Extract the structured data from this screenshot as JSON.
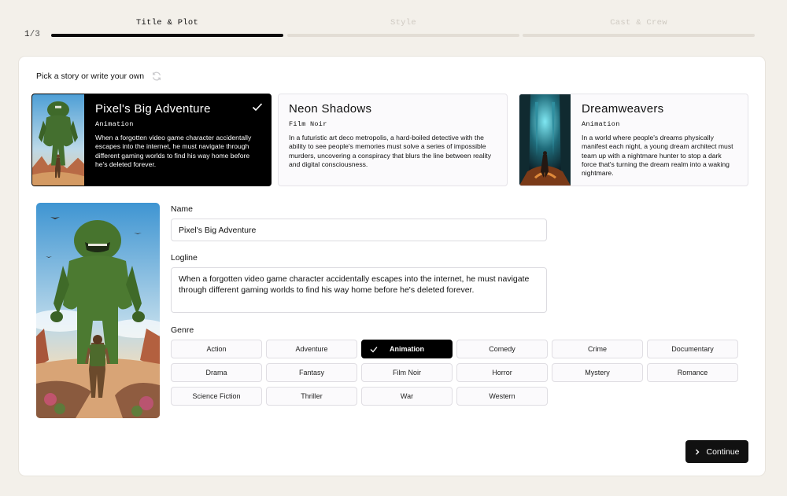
{
  "stepper": {
    "counter_current": "1",
    "counter_total": "/3",
    "steps": [
      {
        "label": "Title & Plot",
        "active": true
      },
      {
        "label": "Style",
        "active": false
      },
      {
        "label": "Cast & Crew",
        "active": false
      }
    ]
  },
  "picker": {
    "label": "Pick a story or write your own",
    "refresh_icon": "refresh-icon"
  },
  "stories": [
    {
      "title": "Pixel's Big Adventure",
      "genre": "Animation",
      "description": "When a forgotten video game character accidentally escapes into the internet, he must navigate through different gaming worlds to find his way home before he's deleted forever.",
      "selected": true
    },
    {
      "title": "Neon Shadows",
      "genre": "Film Noir",
      "description": "In a futuristic art deco metropolis, a hard-boiled detective with the ability to see people's memories must solve a series of impossible murders, uncovering a conspiracy that blurs the line between reality and digital consciousness.",
      "selected": false
    },
    {
      "title": "Dreamweavers",
      "genre": "Animation",
      "description": "In a world where people's dreams physically manifest each night, a young dream architect must team up with a nightmare hunter to stop a dark force that's turning the dream realm into a waking nightmare.",
      "selected": false
    }
  ],
  "form": {
    "name_label": "Name",
    "name_value": "Pixel's Big Adventure",
    "logline_label": "Logline",
    "logline_value": "When a forgotten video game character accidentally escapes into the internet, he must navigate through different gaming worlds to find his way home before he's deleted forever.",
    "genre_label": "Genre",
    "genres": [
      {
        "label": "Action",
        "selected": false
      },
      {
        "label": "Adventure",
        "selected": false
      },
      {
        "label": "Animation",
        "selected": true
      },
      {
        "label": "Comedy",
        "selected": false
      },
      {
        "label": "Crime",
        "selected": false
      },
      {
        "label": "Documentary",
        "selected": false
      },
      {
        "label": "Drama",
        "selected": false
      },
      {
        "label": "Fantasy",
        "selected": false
      },
      {
        "label": "Film Noir",
        "selected": false
      },
      {
        "label": "Horror",
        "selected": false
      },
      {
        "label": "Mystery",
        "selected": false
      },
      {
        "label": "Romance",
        "selected": false
      },
      {
        "label": "Science Fiction",
        "selected": false
      },
      {
        "label": "Thriller",
        "selected": false
      },
      {
        "label": "War",
        "selected": false
      },
      {
        "label": "Western",
        "selected": false
      }
    ]
  },
  "actions": {
    "continue_label": "Continue",
    "continue_icon": "chevron-right-icon"
  },
  "colors": {
    "background": "#f3f0ea",
    "accent": "#000000",
    "card_bg": "#ffffff"
  }
}
